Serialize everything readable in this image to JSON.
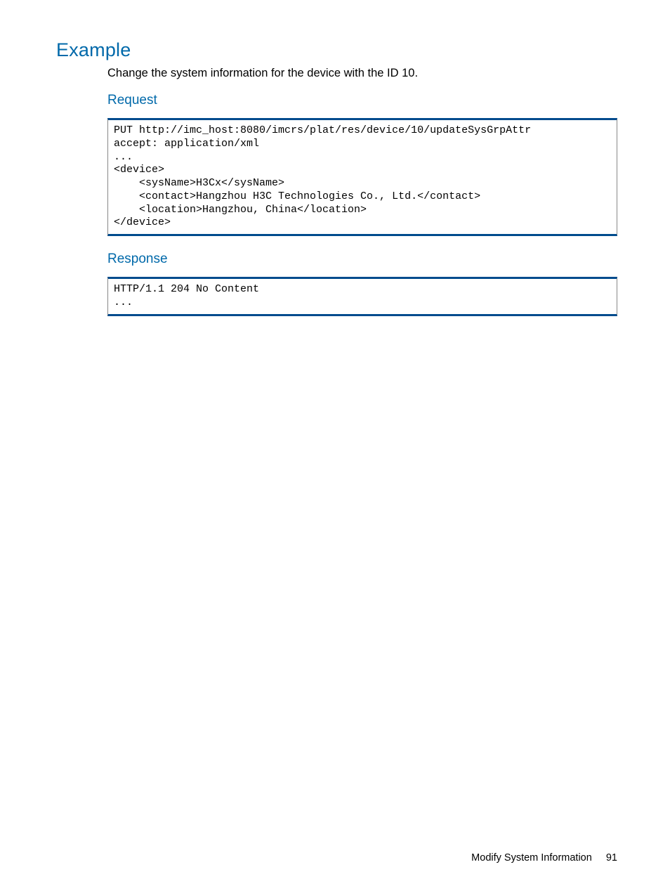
{
  "headings": {
    "example": "Example",
    "request": "Request",
    "response": "Response"
  },
  "intro": "Change the system information for the device with the ID 10.",
  "code": {
    "request": "PUT http://imc_host:8080/imcrs/plat/res/device/10/updateSysGrpAttr\naccept: application/xml\n...\n<device>\n    <sysName>H3Cx</sysName>\n    <contact>Hangzhou H3C Technologies Co., Ltd.</contact>\n    <location>Hangzhou, China</location>\n</device>",
    "response": "HTTP/1.1 204 No Content\n..."
  },
  "footer": {
    "title": "Modify System Information",
    "page": "91"
  }
}
